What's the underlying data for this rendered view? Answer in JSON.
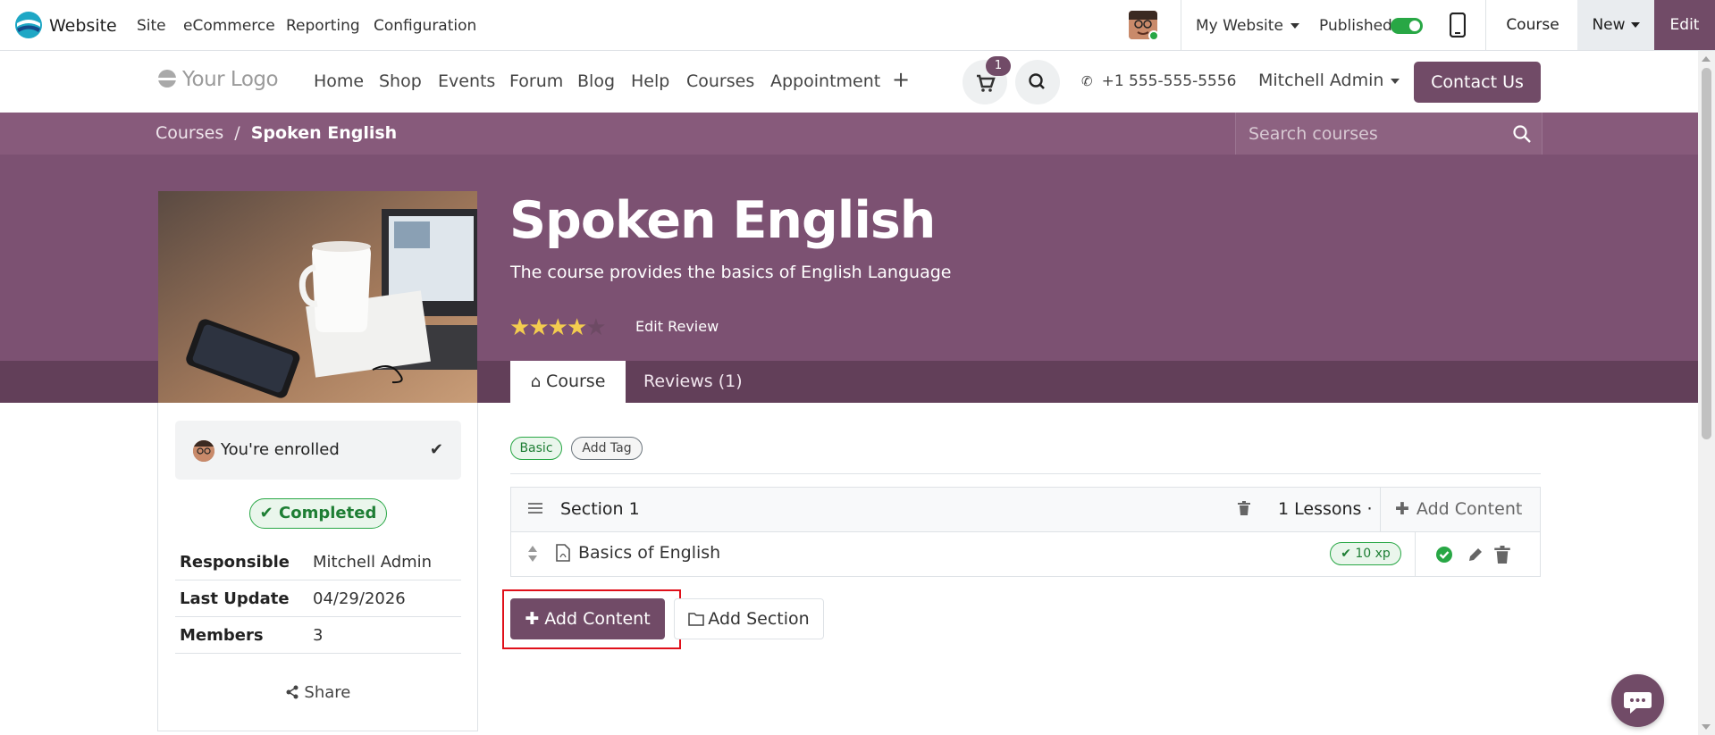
{
  "admin_bar": {
    "app_name": "Website",
    "menu": [
      "Site",
      "eCommerce",
      "Reporting",
      "Configuration"
    ],
    "my_website": "My Website",
    "published_label": "Published",
    "published": true,
    "course_label": "Course",
    "new_label": "New",
    "edit_label": "Edit"
  },
  "header": {
    "logo_text": "Your Logo",
    "nav": [
      "Home",
      "Shop",
      "Events",
      "Forum",
      "Blog",
      "Help",
      "Courses",
      "Appointment"
    ],
    "cart_count": "1",
    "phone": "+1 555-555-5556",
    "user": "Mitchell Admin",
    "contact_button": "Contact Us"
  },
  "breadcrumb": {
    "parent": "Courses",
    "separator": "/",
    "current": "Spoken English"
  },
  "search": {
    "placeholder": "Search courses"
  },
  "course": {
    "title": "Spoken English",
    "subtitle": "The course provides the basics of English Language",
    "rating": 4,
    "rating_max": 5,
    "edit_review": "Edit Review",
    "tabs": [
      "Course",
      "Reviews (1)"
    ]
  },
  "sidebar": {
    "enrolled_text": "You're enrolled",
    "status_badge": "Completed",
    "info": [
      {
        "label": "Responsible",
        "value": "Mitchell Admin"
      },
      {
        "label": "Last Update",
        "value": "04/29/2026"
      },
      {
        "label": "Members",
        "value": "3"
      }
    ],
    "share_label": "Share"
  },
  "content": {
    "tags": [
      "Basic",
      "Add Tag"
    ],
    "section": {
      "name": "Section 1",
      "lessons_count": "1 Lessons ·",
      "add_content": "Add Content"
    },
    "lesson": {
      "name": "Basics of English",
      "xp": "10 xp"
    },
    "add_content_button": "Add Content",
    "add_section_button": "Add Section"
  },
  "colors": {
    "brand": "#714b67",
    "hero": "#7c5172",
    "success": "#28a745",
    "highlight": "#e0101a"
  }
}
